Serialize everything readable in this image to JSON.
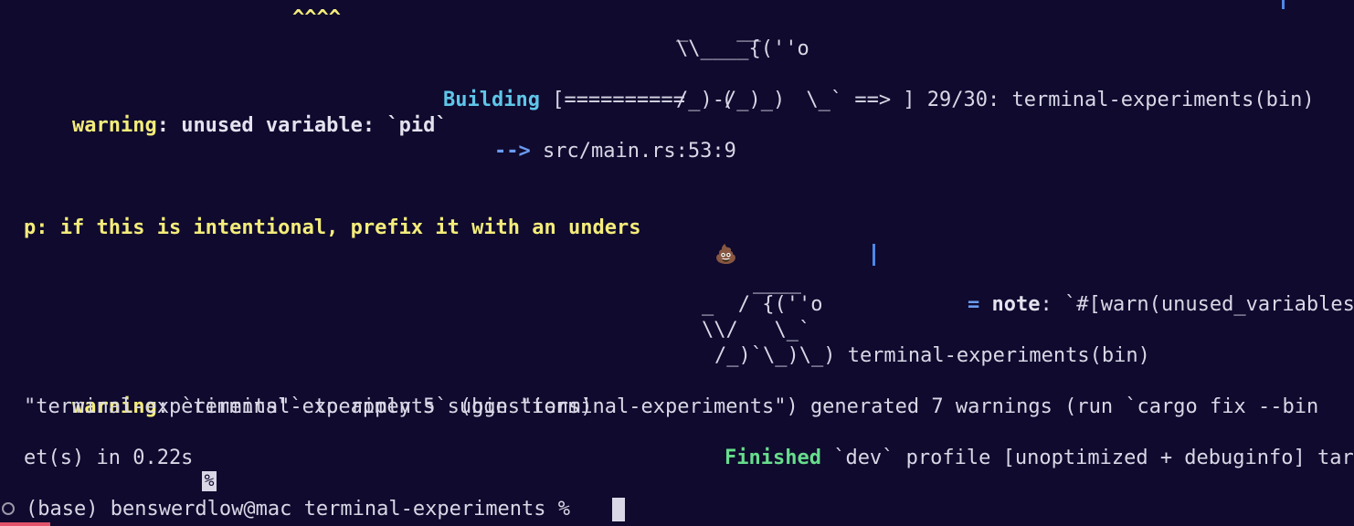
{
  "terminal": {
    "background": "#0f0a2e",
    "caret_marks": "^^^^",
    "ascii_top_1": "_    __",
    "ascii_top_2": "\\\\____{(''o",
    "building_label": "Building",
    "building_bar": " [==========   (      \\_` ==> ] 29/30: terminal-experiments(bin)",
    "warning_label": "warning",
    "warning_msg": ": unused variable: `pid`",
    "ascii_top_4": "/_)-/_)_)",
    "arrow": "-->",
    "location": " src/main.rs:53:9",
    "help_text": "p: if this is intentional, prefix it with an unders",
    "poop_emoji": "💩",
    "note_eq": "= ",
    "note_label": "note",
    "note_msg": ": `#[warn(unused_variables)]",
    "ascii_bot_1": "____",
    "ascii_bot_2": "_  / {(''o",
    "ascii_bot_3": "\\\\/   \\_`",
    "ascii_bot_4": "/_)`\\_)\\_) terminal-experiments(bin)",
    "summary_label": "warning",
    "summary_msg_1": ": `terminal-experiments` (bin \"terminal-experiments\") generated 7 warnings (run `cargo fix --bin",
    "summary_msg_2": "\"terminal-experiments\"` to apply 5 suggestions)",
    "finished_label": "Finished",
    "finished_msg": " `dev` profile [unoptimized + debuginfo] targ",
    "finished_tail": "et(s) in 0.22s",
    "percent_marker": "%",
    "prompt": "(base) benswerdlow@mac terminal-experiments % "
  }
}
